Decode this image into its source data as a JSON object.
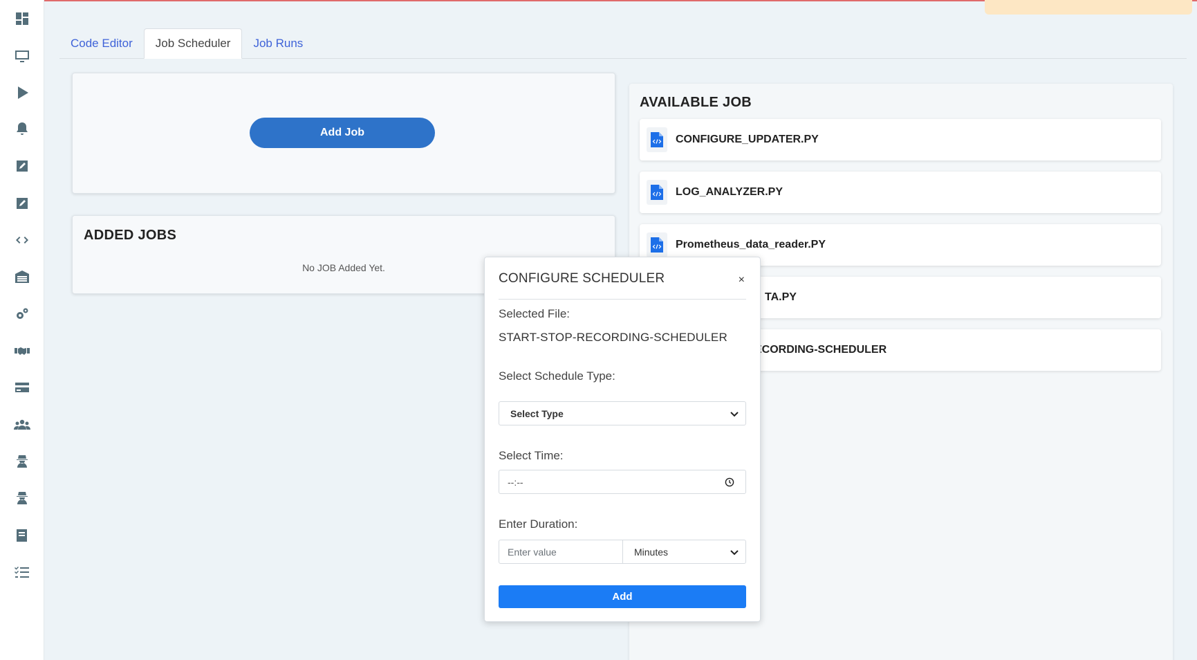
{
  "tabs": [
    {
      "label": "Code Editor",
      "active": false
    },
    {
      "label": "Job Scheduler",
      "active": true
    },
    {
      "label": "Job Runs",
      "active": false
    }
  ],
  "scheduler": {
    "add_job_label": "Add Job",
    "added_jobs_title": "ADDED JOBS",
    "empty_message": "No JOB Added Yet."
  },
  "available": {
    "title": "AVAILABLE JOB",
    "jobs": [
      {
        "name": "CONFIGURE_UPDATER.PY"
      },
      {
        "name": "LOG_ANALYZER.PY"
      },
      {
        "name": "Prometheus_data_reader.PY"
      },
      {
        "name": "TA.PY"
      },
      {
        "name": "ECORDING-SCHEDULER"
      }
    ]
  },
  "modal": {
    "title": "CONFIGURE SCHEDULER",
    "close_glyph": "×",
    "selected_file_label": "Selected File:",
    "selected_file": "START-STOP-RECORDING-SCHEDULER",
    "schedule_type_label": "Select Schedule Type:",
    "schedule_type_value": "Select Type",
    "time_label": "Select Time:",
    "time_value": "--:--",
    "duration_label": "Enter Duration:",
    "duration_placeholder": "Enter value",
    "duration_unit": "Minutes",
    "add_label": "Add"
  },
  "sidebar_icons": [
    "dashboard-icon",
    "monitor-icon",
    "play-icon",
    "bell-icon",
    "edit-square-icon",
    "edit-square-icon",
    "code-icon",
    "warehouse-icon",
    "gears-icon",
    "handshake-icon",
    "credit-card-icon",
    "users-icon",
    "user-secret-icon",
    "user-secret-icon",
    "book-icon",
    "tasks-list-icon"
  ],
  "colors": {
    "accent": "#2e73c9",
    "primary_button": "#1b7cf5",
    "tab_link": "#3f63d8",
    "background": "#edf3f7"
  }
}
